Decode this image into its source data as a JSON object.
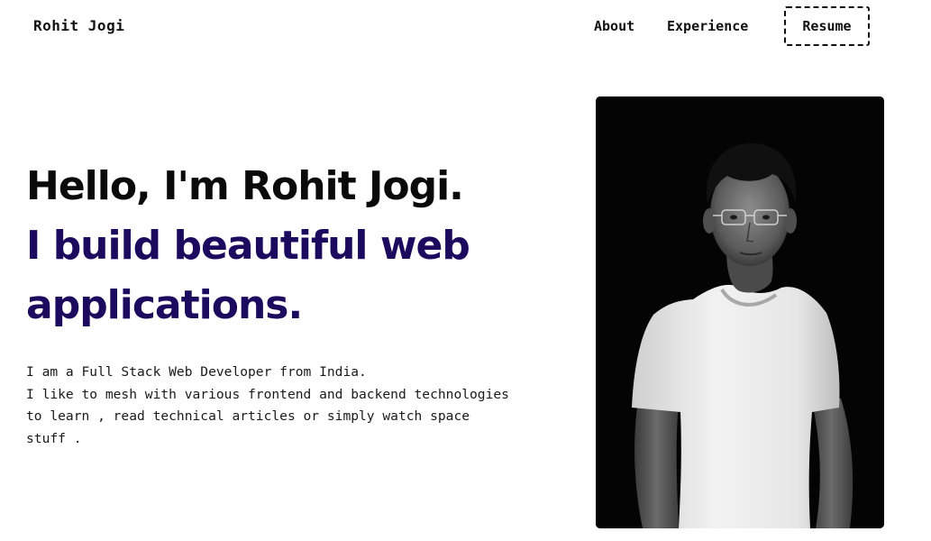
{
  "nav": {
    "brand": "Rohit Jogi",
    "links": [
      {
        "label": "About"
      },
      {
        "label": "Experience"
      }
    ],
    "resume_label": "Resume"
  },
  "hero": {
    "greeting": "Hello, I'm Rohit Jogi.",
    "tagline": "I build beautiful web applications.",
    "description_lines": [
      "I am a Full Stack Web Developer from India.",
      "I like to mesh with various frontend and backend technologies",
      "to learn , read technical articles or simply watch space",
      "stuff ."
    ]
  },
  "portrait": {
    "icon": "person-photo"
  },
  "colors": {
    "text": "#0a0a0a",
    "accent": "#1b0a5e",
    "photo_bg": "#040404"
  }
}
